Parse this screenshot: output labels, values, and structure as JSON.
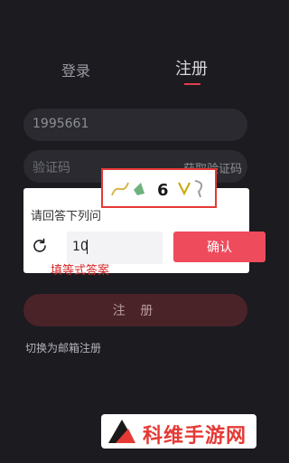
{
  "tabs": {
    "login": "登录",
    "register": "注册"
  },
  "form": {
    "phone_value": "1995661",
    "code_placeholder": "验证码",
    "get_code_label": "获取验证码"
  },
  "captcha": {
    "prompt": "请回答下列问",
    "image_text": "6",
    "answer_value": "10",
    "confirm_label": "确认",
    "annotation": "填等式答案"
  },
  "register_button_label": "注 册",
  "switch_link": "切换为邮箱注册",
  "watermark": {
    "text": "科维手游网"
  },
  "colors": {
    "accent": "#ee4b5d",
    "highlight": "#e53935",
    "background": "#1b1b20"
  }
}
